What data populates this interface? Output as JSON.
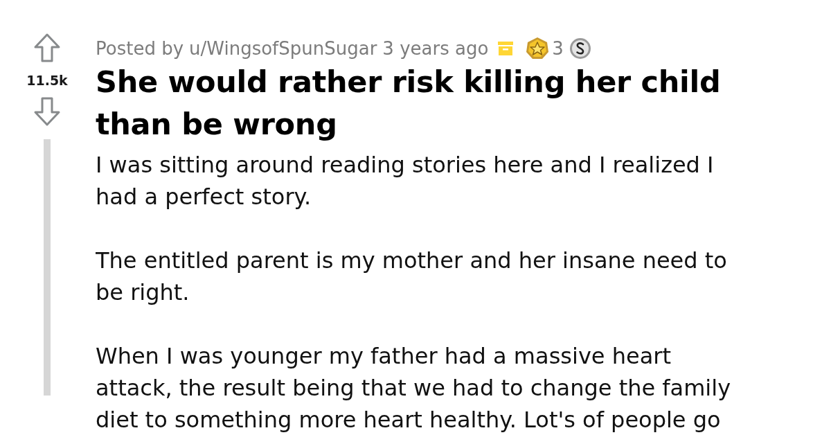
{
  "post": {
    "score": "11.5k",
    "meta": {
      "prefix": "Posted by",
      "author": "u/WingsofSpunSugar",
      "time": "3 years ago",
      "award_count": "3"
    },
    "title_lines": [
      "She would rather risk killing her child",
      "than be wrong"
    ],
    "paragraphs": [
      {
        "lines": [
          "I was sitting around reading stories here and I realized I",
          "had a perfect story."
        ]
      },
      {
        "lines": [
          "The entitled parent is my mother and her insane need to",
          "be right."
        ]
      },
      {
        "lines": [
          "When I was younger my father had a massive heart",
          "attack, the result being that we had to change the family",
          "diet to something more heart healthy. Lot's of people go"
        ]
      }
    ]
  }
}
